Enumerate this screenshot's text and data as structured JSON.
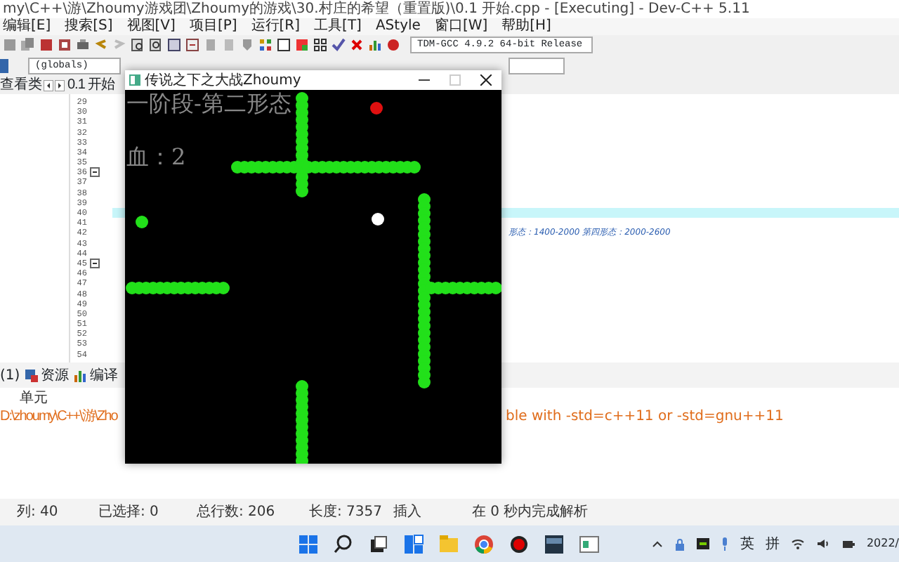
{
  "window": {
    "title": "my\\C++\\游\\Zhoumy游戏团\\Zhoumy的游戏\\30.村庄的希望（重置版)\\0.1 开始.cpp - [Executing] - Dev-C++ 5.11"
  },
  "menu": [
    "编辑[E]",
    "搜索[S]",
    "视图[V]",
    "项目[P]",
    "运行[R]",
    "工具[T]",
    "AStyle",
    "窗口[W]",
    "帮助[H]"
  ],
  "toolbar": {
    "compiler": "TDM-GCC 4.9.2 64-bit Release"
  },
  "scope_bar": {
    "scope": "(globals)"
  },
  "class_tab": {
    "label": "查看类"
  },
  "file_tab": {
    "label": "0.1 开始"
  },
  "editor": {
    "lines": [
      {
        "number": "29"
      },
      {
        "number": "30"
      },
      {
        "number": "31"
      },
      {
        "number": "32"
      },
      {
        "number": "33"
      },
      {
        "number": "34"
      },
      {
        "number": "35"
      },
      {
        "number": "36",
        "fold_marker": true
      },
      {
        "number": "37"
      },
      {
        "number": "38"
      },
      {
        "number": "39"
      },
      {
        "number": "40",
        "current": true
      },
      {
        "number": "41"
      },
      {
        "number": "42",
        "text": "形态：1400-2000  第四形态：2000-2600"
      },
      {
        "number": "43"
      },
      {
        "number": "44"
      },
      {
        "number": "45",
        "fold_marker": true
      },
      {
        "number": "46"
      },
      {
        "number": "47"
      },
      {
        "number": "48"
      },
      {
        "number": "49"
      },
      {
        "number": "50"
      },
      {
        "number": "51"
      },
      {
        "number": "52"
      },
      {
        "number": "53"
      },
      {
        "number": "54"
      }
    ]
  },
  "bottom_tabs": [
    {
      "label": "(1)",
      "kind": "errors",
      "selected": false
    },
    {
      "label": "资源",
      "kind": "resources",
      "selected": false
    },
    {
      "label": "编译",
      "kind": "log",
      "selected": false
    }
  ],
  "messages": {
    "columns": [
      "单元"
    ],
    "rows": [
      {
        "unit": "D:\\zhoumy\\C++\\游\\Zho",
        "message": "ble with -std=c++11 or -std=gnu++11"
      }
    ]
  },
  "status_bar": [
    {
      "label": "列:",
      "value": "40"
    },
    {
      "label": "已选择:",
      "value": "0"
    },
    {
      "label": "总行数:",
      "value": "206"
    },
    {
      "label": "长度:",
      "value": "7357"
    },
    {
      "label": "插入"
    },
    {
      "label": "在 0 秒内完成解析"
    }
  ],
  "taskbar": {
    "tray": [
      "英",
      "拼"
    ],
    "clock": "2022/"
  },
  "game_window": {
    "title": "传说之下之大战Zhoumy",
    "stage": "一阶段-第二形态",
    "health": "血：2"
  }
}
